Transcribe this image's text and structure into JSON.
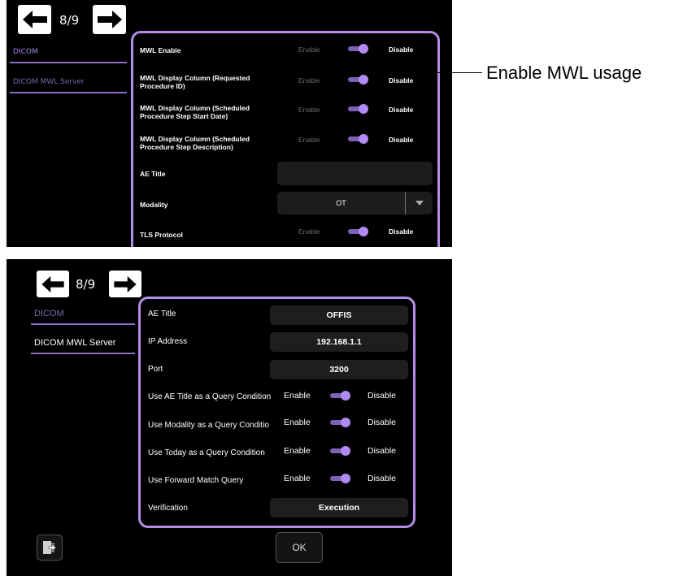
{
  "colors": {
    "accent": "#b48ee6",
    "toggle_track": "#7c62b5",
    "toggle_knob": "#b18af4",
    "background": "#000000"
  },
  "screen1": {
    "page_indicator": "8/9",
    "sidebar": [
      {
        "label": "DICOM",
        "state": "active"
      },
      {
        "label": "DICOM MWL Server",
        "state": "inactive"
      }
    ],
    "rows": [
      {
        "label": "MWL Enable",
        "enable": "Enable",
        "disable": "Disable"
      },
      {
        "label": "MWL Display Column (Requested Procedure ID)",
        "enable": "Enable",
        "disable": "Disable"
      },
      {
        "label": "MWL Display Column (Scheduled Procedure Step Start Date)",
        "enable": "Enable",
        "disable": "Disable"
      },
      {
        "label": "MWL Display Column (Scheduled Procedure Step Description)",
        "enable": "Enable",
        "disable": "Disable"
      }
    ],
    "ae_title": {
      "label": "AE Title",
      "value": ""
    },
    "modality": {
      "label": "Modality",
      "value": "OT"
    },
    "tls": {
      "label": "TLS Protocol",
      "enable": "Enable",
      "disable": "Disable"
    }
  },
  "screen2": {
    "page_indicator": "8/9",
    "sidebar": [
      {
        "label": "DICOM",
        "state": "inactive"
      },
      {
        "label": "DICOM MWL Server",
        "state": "selected"
      }
    ],
    "fields": [
      {
        "label": "AE Title",
        "value": "OFFIS"
      },
      {
        "label": "IP Address",
        "value": "192.168.1.1"
      },
      {
        "label": "Port",
        "value": "3200"
      }
    ],
    "toggles": [
      {
        "label": "Use AE Title as a Query Condition",
        "enable": "Enable",
        "disable": "Disable"
      },
      {
        "label": "Use Modality as a Query Conditio",
        "enable": "Enable",
        "disable": "Disable"
      },
      {
        "label": "Use Today as a Query Condition",
        "enable": "Enable",
        "disable": "Disable"
      },
      {
        "label": "Use Forward Match Query",
        "enable": "Enable",
        "disable": "Disable"
      }
    ],
    "verification": {
      "label": "Verification",
      "value": "Execution"
    },
    "ok_label": "OK",
    "exit_icon": "exit-door-icon"
  },
  "callout": {
    "text": "Enable MWL usage"
  }
}
